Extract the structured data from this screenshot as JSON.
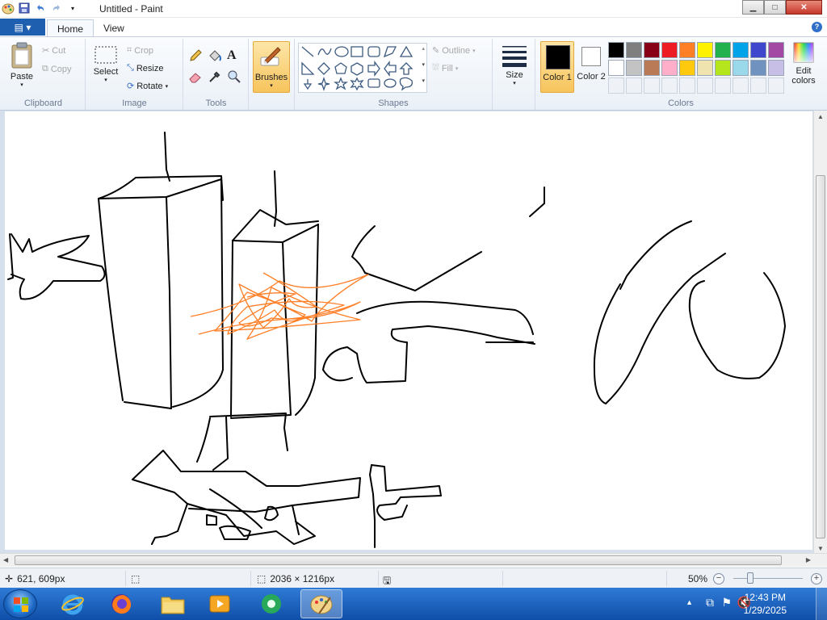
{
  "window": {
    "title": "Untitled - Paint",
    "controls": {
      "minimize": "▁",
      "maximize": "□",
      "close": "✕"
    }
  },
  "tabs": {
    "home": "Home",
    "view": "View"
  },
  "ribbon": {
    "clipboard": {
      "label": "Clipboard",
      "paste": "Paste",
      "cut": "Cut",
      "copy": "Copy"
    },
    "image": {
      "label": "Image",
      "select": "Select",
      "crop": "Crop",
      "resize": "Resize",
      "rotate": "Rotate"
    },
    "tools": {
      "label": "Tools"
    },
    "brushes": {
      "label": "Brushes"
    },
    "shapes": {
      "label": "Shapes",
      "outline": "Outline",
      "fill": "Fill"
    },
    "size": {
      "label": "Size"
    },
    "colors": {
      "label": "Colors",
      "color1": "Color 1",
      "color2": "Color 2",
      "edit": "Edit colors",
      "color1_value": "#000000",
      "color2_value": "#ffffff",
      "palette": [
        "#000000",
        "#7f7f7f",
        "#880015",
        "#ed1c24",
        "#ff7f27",
        "#fff200",
        "#22b14c",
        "#00a2e8",
        "#3f48cc",
        "#a349a4",
        "#ffffff",
        "#c3c3c3",
        "#b97a57",
        "#ffaec9",
        "#ffc90e",
        "#efe4b0",
        "#b5e61d",
        "#99d9ea",
        "#7092be",
        "#c8bfe7"
      ]
    }
  },
  "status": {
    "cursor_pos": "621, 609px",
    "canvas_size": "2036 × 1216px",
    "zoom": "50%"
  },
  "taskbar": {
    "time": "12:43 PM",
    "date": "1/29/2025"
  }
}
